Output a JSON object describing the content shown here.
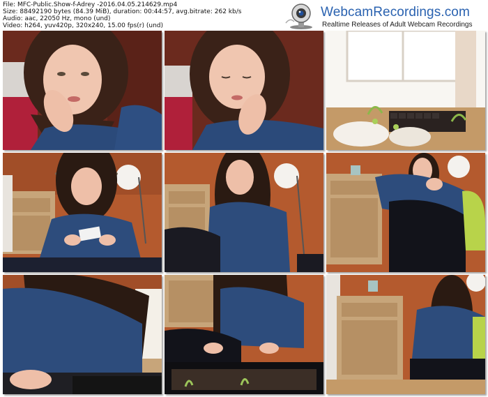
{
  "file_info": {
    "file": "File: MFC-Public.Show-f-Adrey -2016.04.05.214629.mp4",
    "size": "Size: 88492190 bytes (84.39 MiB), duration: 00:44:57, avg.bitrate: 262 kb/s",
    "audio": "Audio: aac, 22050 Hz, mono (und)",
    "video": "Video: h264, yuv420p, 320x240, 15.00 fps(r) (und)"
  },
  "logo": {
    "site": "WebcamRecordings.com",
    "tagline": "Realtime Releases of Adult Webcam Recordings",
    "icon": "webcam-icon",
    "color": "#2a62b0"
  },
  "thumbnails": [
    {
      "scene": "close-up-hand-on-cheek"
    },
    {
      "scene": "close-up-eyes-closed"
    },
    {
      "scene": "window-with-plant-trays"
    },
    {
      "scene": "sitting-with-hat-holding-cards"
    },
    {
      "scene": "sitting-in-front-of-lamp"
    },
    {
      "scene": "leaning-near-chair"
    },
    {
      "scene": "close-reaching-down"
    },
    {
      "scene": "planting-seedlings"
    },
    {
      "scene": "sitting-by-dresser"
    }
  ]
}
